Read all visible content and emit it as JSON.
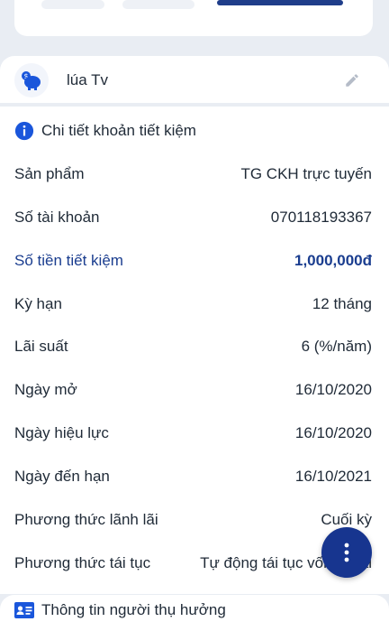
{
  "account": {
    "name": "lúa Tv",
    "icon": "piggy-bank-icon",
    "edit_icon": "pencil-icon"
  },
  "detail": {
    "title": "Chi tiết khoản tiết kiệm",
    "icon": "info-icon",
    "rows": [
      {
        "label": "Sản phẩm",
        "value": "TG CKH trực tuyến"
      },
      {
        "label": "Số tài khoản",
        "value": "070118193367"
      },
      {
        "label": "Số tiền tiết kiệm",
        "value": "1,000,000đ"
      },
      {
        "label": "Kỳ hạn",
        "value": "12 tháng"
      },
      {
        "label": "Lãi suất",
        "value": "6 (%/năm)"
      },
      {
        "label": "Ngày mở",
        "value": "16/10/2020"
      },
      {
        "label": "Ngày hiệu lực",
        "value": "16/10/2020"
      },
      {
        "label": "Ngày đến hạn",
        "value": "16/10/2021"
      },
      {
        "label": "Phương thức lãnh lãi",
        "value": "Cuối kỳ"
      },
      {
        "label": "Phương thức tái tục",
        "value": "Tự động tái tục vốn và lãi"
      }
    ]
  },
  "beneficiary": {
    "title": "Thông tin người thụ hưởng",
    "icon": "contact-card-icon"
  },
  "fab": {
    "icon": "more-vertical-icon"
  },
  "colors": {
    "primary": "#17358f",
    "highlight": "#1a3d8f",
    "background": "#e9edf3"
  }
}
